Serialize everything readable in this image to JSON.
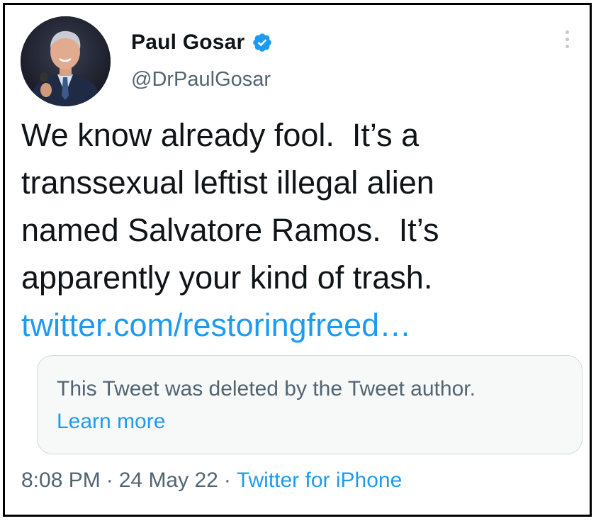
{
  "author": {
    "name": "Paul Gosar",
    "handle": "@DrPaulGosar",
    "avatar_icon": "profile-photo-icon",
    "verified_icon": "verified-badge-icon"
  },
  "tweet": {
    "lines": [
      "We know already fool.  It’s a",
      "transsexual leftist illegal alien",
      "named Salvatore Ramos.  It’s",
      "apparently your kind of trash."
    ],
    "link": "twitter.com/restoringfreed…"
  },
  "quoted_tweet": {
    "text": "This Tweet was deleted by the Tweet author.",
    "learn_more": "Learn more"
  },
  "meta": {
    "time": "8:08 PM",
    "separator": "·",
    "date": "24 May 22",
    "source": "Twitter for iPhone"
  },
  "colors": {
    "accent": "#1d9bf0",
    "text": "#0f1419",
    "secondary": "#536471"
  }
}
